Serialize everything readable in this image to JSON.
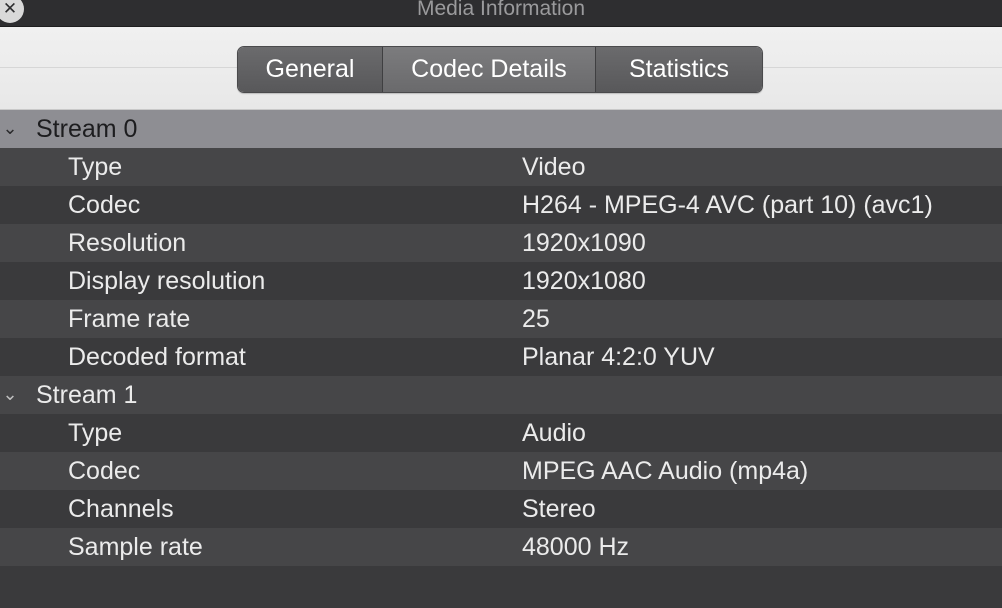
{
  "window": {
    "title": "Media Information",
    "close_icon": "close-circle-icon"
  },
  "tabs": [
    {
      "label": "General",
      "active": false
    },
    {
      "label": "Codec Details",
      "active": true
    },
    {
      "label": "Statistics",
      "active": false
    }
  ],
  "streams": [
    {
      "name": "Stream 0",
      "expanded": true,
      "selected": true,
      "properties": [
        {
          "label": "Type",
          "value": "Video"
        },
        {
          "label": "Codec",
          "value": "H264 - MPEG-4 AVC (part 10) (avc1)"
        },
        {
          "label": "Resolution",
          "value": "1920x1090"
        },
        {
          "label": "Display resolution",
          "value": "1920x1080"
        },
        {
          "label": "Frame rate",
          "value": "25"
        },
        {
          "label": "Decoded format",
          "value": "Planar 4:2:0 YUV"
        }
      ]
    },
    {
      "name": "Stream 1",
      "expanded": true,
      "selected": false,
      "properties": [
        {
          "label": "Type",
          "value": "Audio"
        },
        {
          "label": "Codec",
          "value": "MPEG AAC Audio (mp4a)"
        },
        {
          "label": "Channels",
          "value": "Stereo"
        },
        {
          "label": "Sample rate",
          "value": "48000 Hz"
        }
      ]
    }
  ],
  "icons": {
    "chevron": "chevron-down-icon"
  }
}
